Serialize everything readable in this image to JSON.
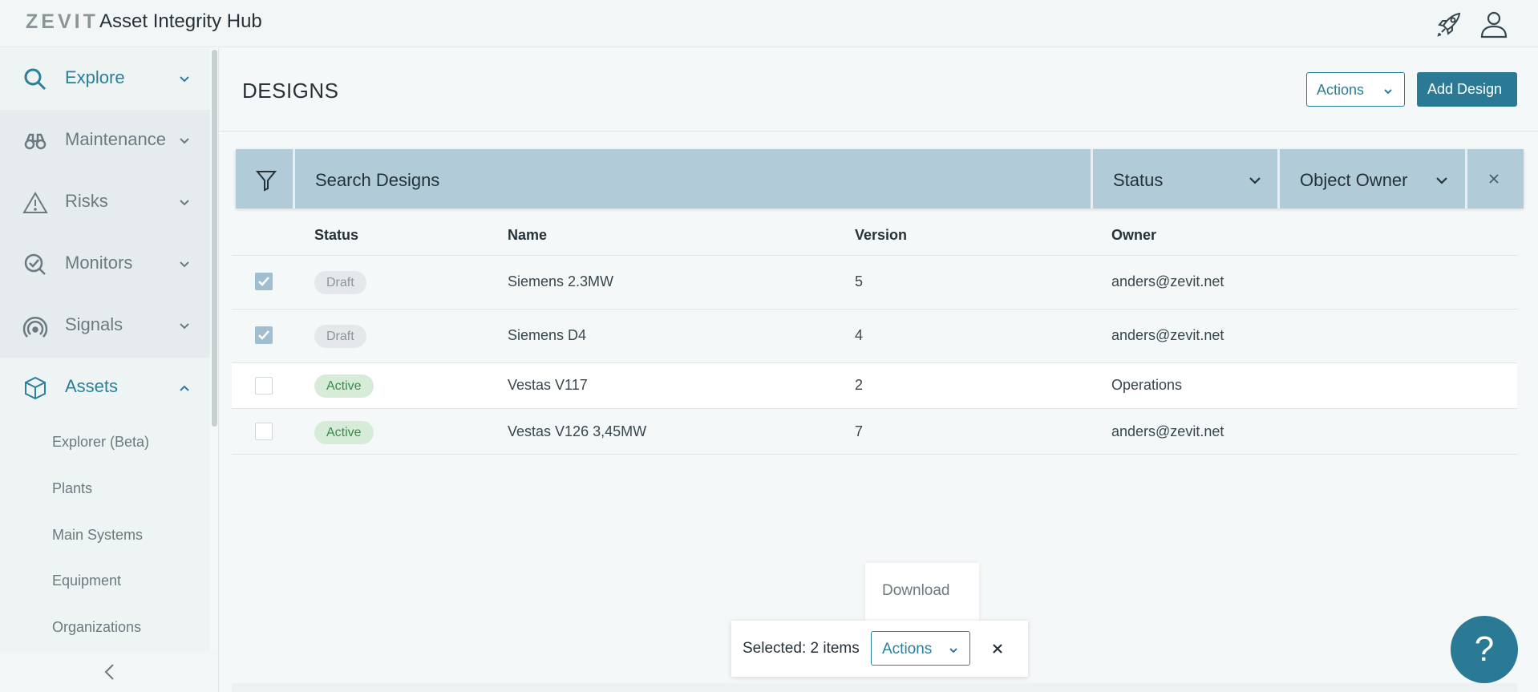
{
  "header": {
    "brand": "ZEVIT",
    "title": "Asset Integrity Hub",
    "icons": [
      "rocket-icon",
      "user-icon"
    ]
  },
  "sidebar": {
    "items": [
      {
        "label": "Explore",
        "icon": "search-icon"
      },
      {
        "label": "Maintenance",
        "icon": "binoculars-icon"
      },
      {
        "label": "Risks",
        "icon": "warning-icon"
      },
      {
        "label": "Monitors",
        "icon": "monitor-check-icon"
      },
      {
        "label": "Signals",
        "icon": "signal-icon"
      },
      {
        "label": "Assets",
        "icon": "cube-icon"
      }
    ],
    "sub_items": [
      "Explorer (Beta)",
      "Plants",
      "Main Systems",
      "Equipment",
      "Organizations"
    ]
  },
  "page": {
    "title": "DESIGNS",
    "actions_label": "Actions",
    "add_label": "Add Design"
  },
  "filter": {
    "search_placeholder": "Search Designs",
    "status_label": "Status",
    "owner_label": "Object Owner"
  },
  "table": {
    "columns": [
      "Status",
      "Name",
      "Version",
      "Owner"
    ],
    "rows": [
      {
        "checked": true,
        "status": "Draft",
        "name": "Siemens 2.3MW",
        "version": "5",
        "owner": "anders@zevit.net"
      },
      {
        "checked": true,
        "status": "Draft",
        "name": "Siemens D4",
        "version": "4",
        "owner": "anders@zevit.net"
      },
      {
        "checked": false,
        "status": "Active",
        "name": "Vestas V117",
        "version": "2",
        "owner": "Operations"
      },
      {
        "checked": false,
        "status": "Active",
        "name": "Vestas V126 3,45MW",
        "version": "7",
        "owner": "anders@zevit.net"
      }
    ]
  },
  "selection": {
    "text": "Selected: 2 items",
    "actions_label": "Actions",
    "menu_item": "Download"
  },
  "help": {
    "label": "?"
  },
  "colors": {
    "accent": "#2a7a95",
    "filter_bg": "#b2cbd9",
    "active_badge": "#d6ecd9",
    "draft_badge": "#e4e8ea"
  }
}
